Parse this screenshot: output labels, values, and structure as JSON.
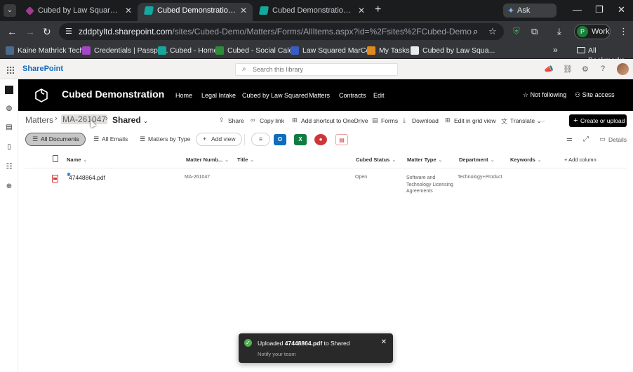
{
  "browser": {
    "tabs": [
      {
        "title": "Cubed by Law Squared - Power Automate",
        "active": false
      },
      {
        "title": "Cubed Demonstration - Matters",
        "active": true
      },
      {
        "title": "Cubed Demonstration - Matters",
        "active": false
      }
    ],
    "ask_gemini": "Ask Gemini",
    "url_host": "zddptyltd.sharepoint.com",
    "url_path": "/sites/Cubed-Demo/Matters/Forms/AllItems.aspx?id=%2Fsites%2FCubed-Demo%2FMatters%2FMA...",
    "profile_initial": "P",
    "profile_label": "Work",
    "bookmarks": [
      {
        "label": "Kaine Mathrick Tech...",
        "color": "#4a6b8a"
      },
      {
        "label": "Credentials | Passpo...",
        "color": "#a347c9"
      },
      {
        "label": "Cubed - Home",
        "color": "#14a79d"
      },
      {
        "label": "Cubed - Social Cale...",
        "color": "#2e8b3a"
      },
      {
        "label": "Law Squared MarCo...",
        "color": "#3b5cc4"
      },
      {
        "label": "My Tasks",
        "color": "#e08a1e"
      },
      {
        "label": "Cubed by Law Squa...",
        "color": "#e8eaed"
      }
    ],
    "all_bookmarks": "All Bookmarks"
  },
  "suite": {
    "app_name": "SharePoint",
    "search_placeholder": "Search this library"
  },
  "site": {
    "title": "Cubed Demonstration",
    "nav": [
      "Home",
      "Legal Intake",
      "Cubed by Law Squared",
      "Matters",
      "Contracts",
      "Edit"
    ],
    "not_following": "Not following",
    "site_access": "Site access"
  },
  "breadcrumb": [
    "Matters",
    "MA-261047",
    "Shared"
  ],
  "commands": [
    "Share",
    "Copy link",
    "Add shortcut to OneDrive",
    "Forms",
    "Download",
    "Edit in grid view",
    "Translate"
  ],
  "create_upload": "Create or upload",
  "views": [
    "All Documents",
    "All Emails",
    "Matters by Type",
    "Add view"
  ],
  "details_label": "Details",
  "columns": [
    "Name",
    "Matter Numb...",
    "Title",
    "Cubed Status",
    "Matter Type",
    "Department",
    "Keywords",
    "Add column"
  ],
  "rows": [
    {
      "name": "47448864.pdf",
      "matter_number": "MA-261047",
      "title": "",
      "status": "Open",
      "matter_type": "Software and Technology Licensing Agreements",
      "department": "Technology+Product",
      "keywords": ""
    }
  ],
  "toast": {
    "prefix": "Uploaded",
    "file": "47448864.pdf",
    "suffix": "to Shared",
    "sub": "Notify your team"
  }
}
